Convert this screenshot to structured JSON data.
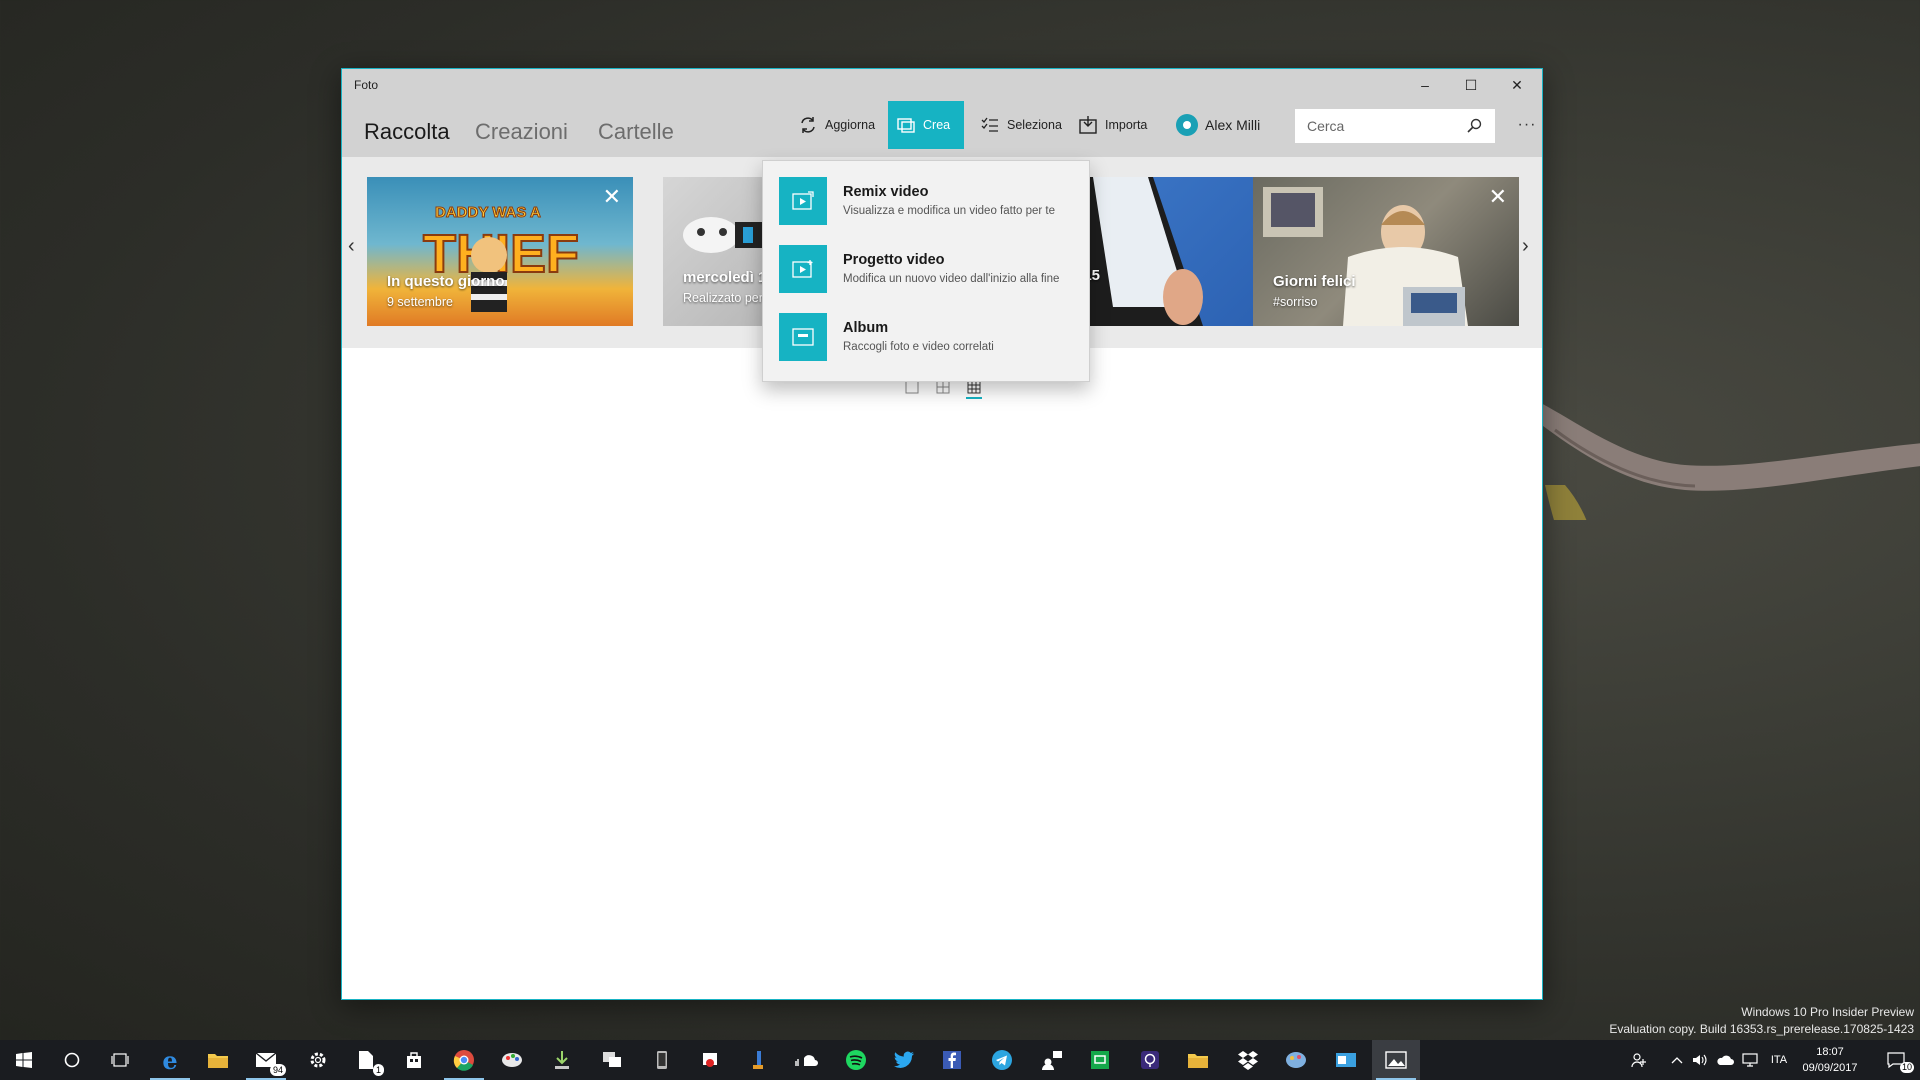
{
  "watermark": {
    "line1": "Windows 10 Pro Insider Preview",
    "line2": "Evaluation copy. Build 16353.rs_prerelease.170825-1423"
  },
  "window": {
    "title": "Foto",
    "controls": {
      "minimize": "–",
      "maximize": "☐",
      "close": "✕"
    }
  },
  "nav": {
    "tabs": [
      {
        "label": "Raccolta",
        "active": true
      },
      {
        "label": "Creazioni",
        "active": false
      },
      {
        "label": "Cartelle",
        "active": false
      }
    ]
  },
  "commands": {
    "refresh": "Aggiorna",
    "create": "Crea",
    "select": "Seleziona",
    "import": "Importa",
    "account": "Alex Milli",
    "search_placeholder": "Cerca",
    "more": "···"
  },
  "cards": [
    {
      "title": "In questo giorno",
      "subtitle": "9 settembre"
    },
    {
      "title": "mercoledì 1",
      "subtitle": "Realizzato per"
    },
    {
      "title": "015",
      "subtitle": ""
    },
    {
      "title": "Giorni felici",
      "subtitle": "#sorriso"
    }
  ],
  "card_close": "✕",
  "strip_nav": {
    "prev": "‹",
    "next": "›"
  },
  "create_menu": [
    {
      "title": "Remix video",
      "desc": "Visualizza e modifica un video fatto per te",
      "icon": "remix-video-icon"
    },
    {
      "title": "Progetto video",
      "desc": "Modifica un nuovo video dall'inizio alla fine",
      "icon": "video-project-icon"
    },
    {
      "title": "Album",
      "desc": "Raccogli foto e video correlati",
      "icon": "album-icon"
    }
  ],
  "accent_color": "#16b3c3",
  "taskbar": {
    "mail_badge": "94",
    "explorer_badge": "1",
    "tray_lang": "ITA",
    "time": "18:07",
    "date": "09/09/2017",
    "notifications": "10"
  }
}
